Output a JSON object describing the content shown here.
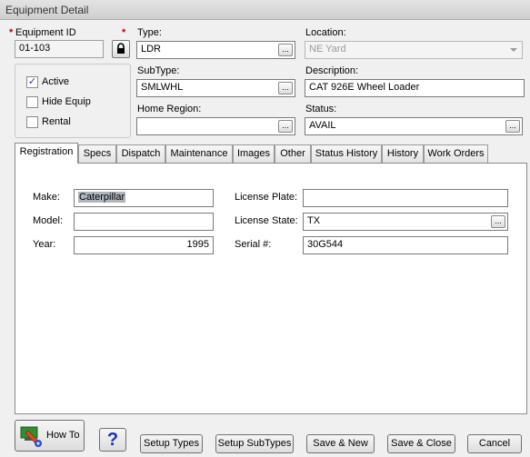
{
  "window": {
    "title": "Equipment Detail"
  },
  "required_marker": "*",
  "equipment_id": {
    "label": "Equipment ID",
    "value": "01-103"
  },
  "type": {
    "label": "Type:",
    "value": "LDR"
  },
  "location": {
    "label": "Location:",
    "value": "NE Yard"
  },
  "subtype": {
    "label": "SubType:",
    "value": "SMLWHL"
  },
  "description": {
    "label": "Description:",
    "value": "CAT 926E Wheel Loader"
  },
  "home_region": {
    "label": "Home Region:",
    "value": ""
  },
  "status": {
    "label": "Status:",
    "value": "AVAIL"
  },
  "flags": {
    "active": {
      "label": "Active",
      "checked": true
    },
    "hide_equip": {
      "label": "Hide Equip",
      "checked": false
    },
    "rental": {
      "label": "Rental",
      "checked": false
    }
  },
  "ellipsis": "...",
  "check_mark": "✓",
  "tabs": [
    "Registration",
    "Specs",
    "Dispatch",
    "Maintenance",
    "Images",
    "Other",
    "Status History",
    "History",
    "Work Orders"
  ],
  "registration": {
    "make": {
      "label": "Make:",
      "value": "Caterpillar"
    },
    "model": {
      "label": "Model:",
      "value": ""
    },
    "year": {
      "label": "Year:",
      "value": "1995"
    },
    "license_plate": {
      "label": "License Plate:",
      "value": ""
    },
    "license_state": {
      "label": "License State:",
      "value": "TX"
    },
    "serial": {
      "label": "Serial #:",
      "value": "30G544"
    }
  },
  "buttons": {
    "how_to": "How To",
    "help": "?",
    "setup_types": "Setup Types",
    "setup_subtypes": "Setup SubTypes",
    "save_new": "Save & New",
    "save_close": "Save & Close",
    "cancel": "Cancel"
  },
  "icons": {
    "lock": "lock-icon",
    "dropdown": "chevron-down-icon",
    "how_to": "howto-icon",
    "help": "help-icon"
  },
  "colors": {
    "required": "#c00000",
    "help": "#1a2fbf"
  }
}
